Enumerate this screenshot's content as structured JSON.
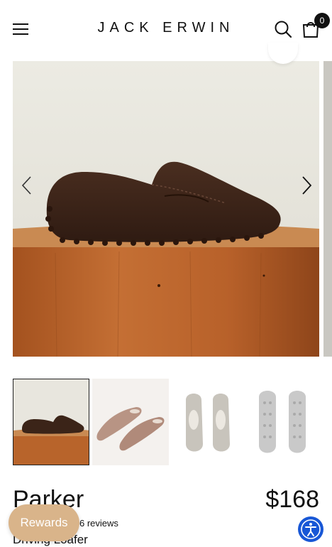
{
  "header": {
    "brand": "JACK ERWIN",
    "cart_count": "0"
  },
  "gallery": {
    "main_image": "brown-suede-loafer-on-wood-pedestal",
    "thumbnails": [
      {
        "name": "loafer-side-view",
        "selected": true
      },
      {
        "name": "loafer-pair-angle",
        "selected": false
      },
      {
        "name": "loafer-pair-top",
        "selected": false
      },
      {
        "name": "loafer-pair-soles",
        "selected": false
      }
    ]
  },
  "product": {
    "title": "Parker",
    "price": "$168",
    "reviews": "6 reviews",
    "subtitle": "Driving Loafer"
  },
  "widgets": {
    "rewards_label": "Rewards"
  },
  "colors": {
    "suede": "#3b2418",
    "wood": "#b7622a",
    "rewards": "#d9b48a",
    "accessibility": "#1857d6"
  }
}
